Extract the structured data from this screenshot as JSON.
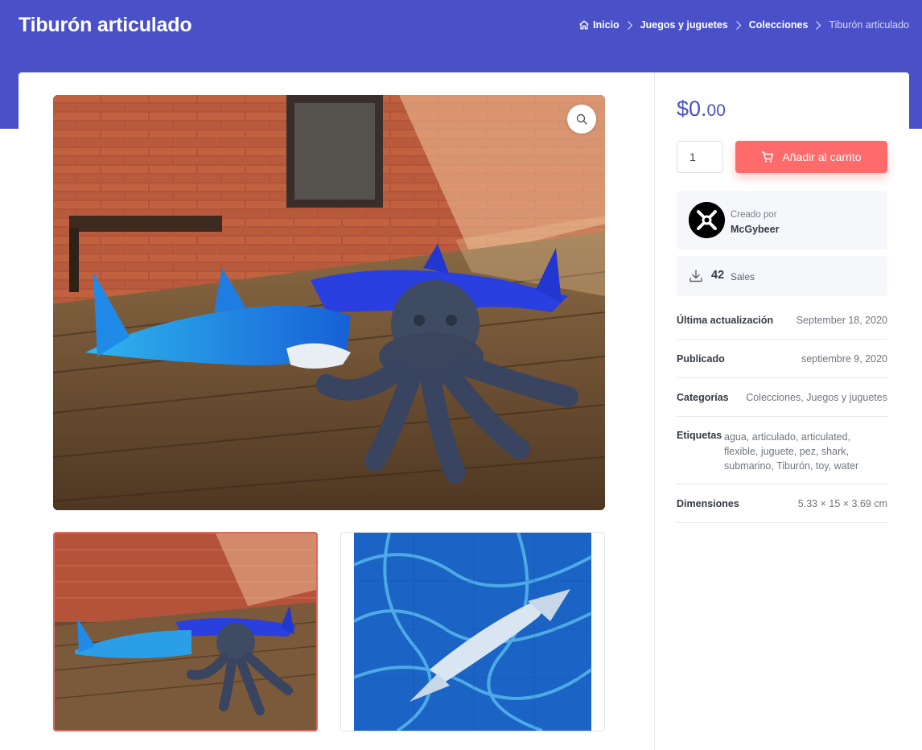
{
  "header": {
    "title": "Tiburón articulado",
    "breadcrumb": [
      {
        "label": "Inicio"
      },
      {
        "label": "Juegos y juguetes"
      },
      {
        "label": "Colecciones"
      },
      {
        "label": "Tiburón articulado"
      }
    ]
  },
  "product": {
    "price_main": "$0.",
    "price_cents": "00",
    "quantity": "1",
    "add_to_cart_label": "Añadir al carrito",
    "author": {
      "label": "Creado por",
      "name": "McGybeer"
    },
    "sales": {
      "count": "42",
      "label": "Sales"
    },
    "meta": [
      {
        "key": "Última actualización",
        "value": "September 18, 2020"
      },
      {
        "key": "Publicado",
        "value": "septiembre 9, 2020"
      },
      {
        "key": "Categorías",
        "value": "Colecciones, Juegos y juguetes"
      },
      {
        "key": "Etiquetas",
        "value": "agua, articulado, articulated, flexible, juguete, pez, shark, submarino, Tiburón, toy, water"
      },
      {
        "key": "Dimensiones",
        "value": "5.33 × 15 × 3.69 cm"
      }
    ]
  },
  "colors": {
    "brand": "#4a51c8",
    "cta": "#ff6b6b",
    "active_thumb_border": "#d86a5e"
  },
  "icons": [
    "home-icon",
    "chevron-right-icon",
    "zoom-icon",
    "cart-icon",
    "download-icon"
  ]
}
